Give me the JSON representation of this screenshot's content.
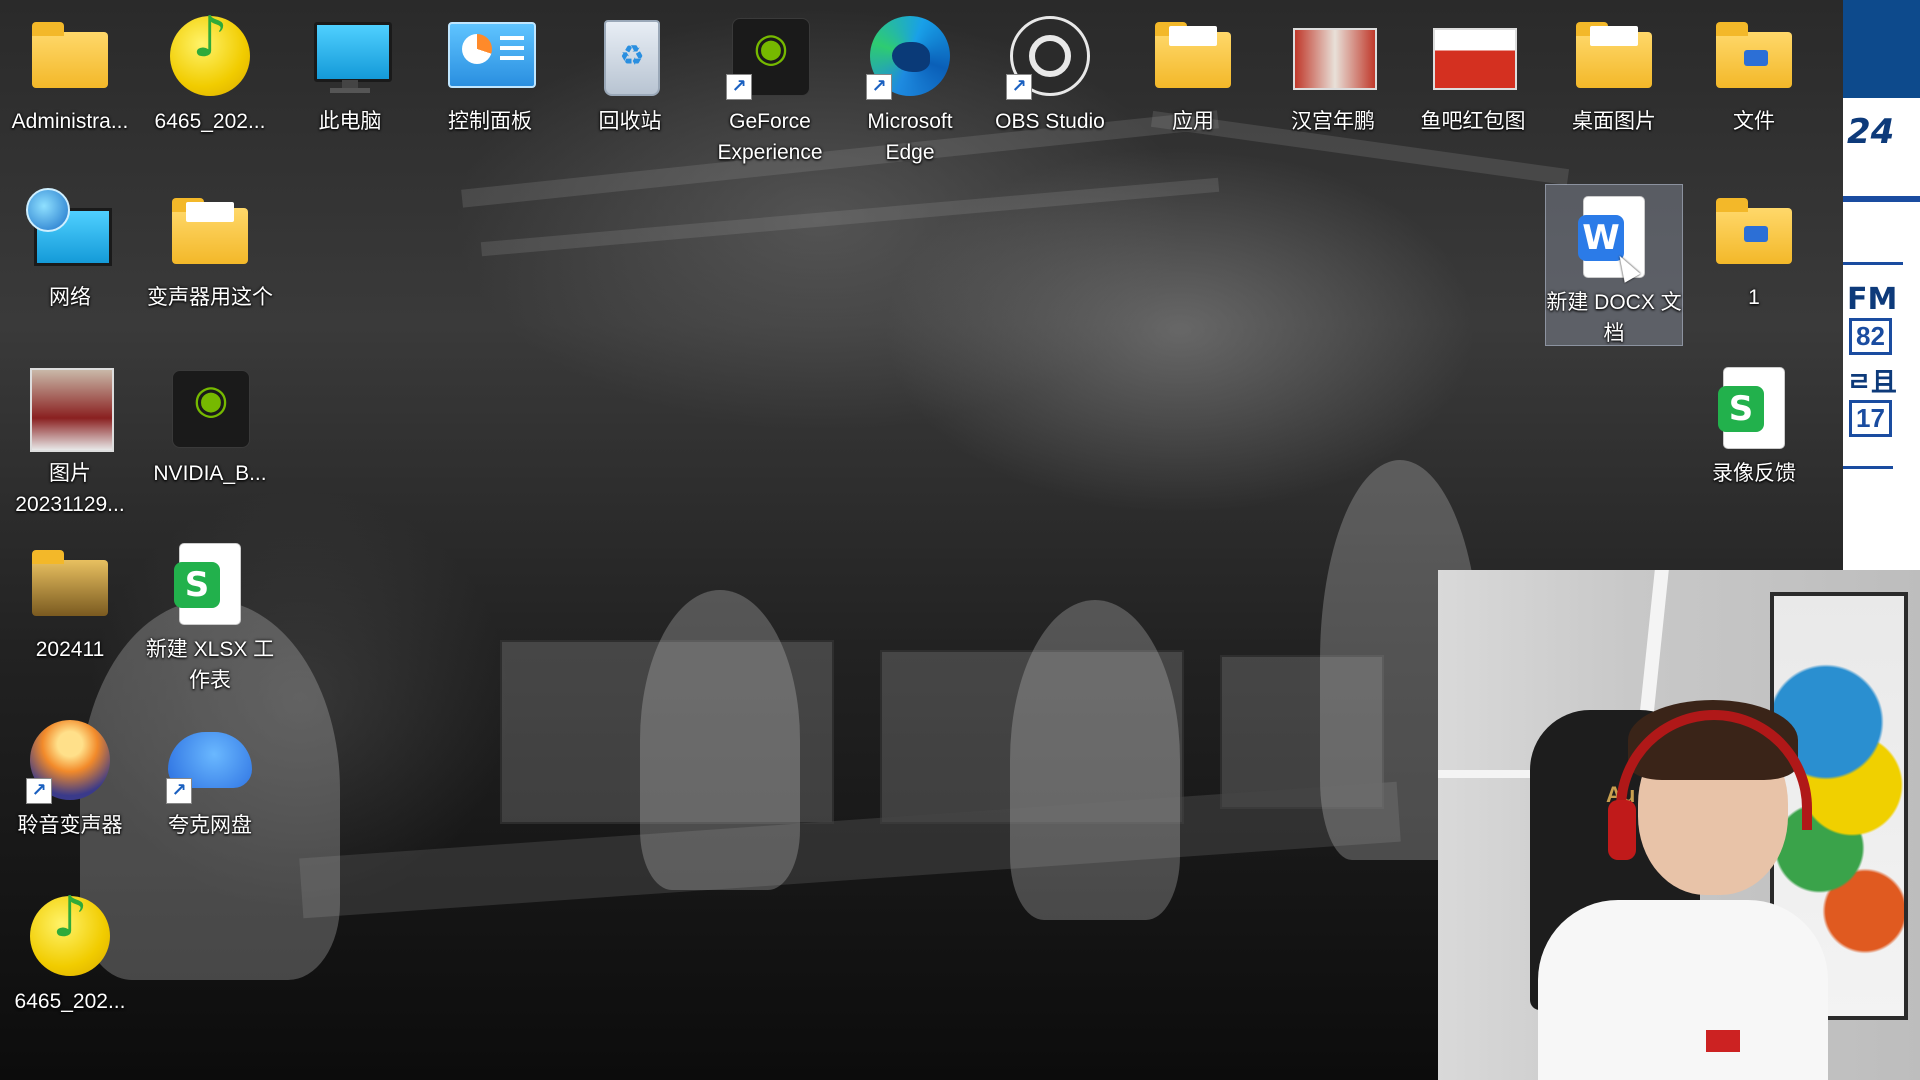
{
  "desktop": {
    "icons": [
      {
        "label": "Administra...",
        "kind": "folder"
      },
      {
        "label": "6465_202...",
        "kind": "music-app"
      },
      {
        "label": "此电脑",
        "kind": "this-pc"
      },
      {
        "label": "控制面板",
        "kind": "control-panel"
      },
      {
        "label": "回收站",
        "kind": "recycle-bin"
      },
      {
        "label": "GeForce Experience",
        "kind": "nvidia-shortcut"
      },
      {
        "label": "Microsoft Edge",
        "kind": "edge-shortcut"
      },
      {
        "label": "OBS Studio",
        "kind": "obs-shortcut"
      },
      {
        "label": "应用",
        "kind": "folder"
      },
      {
        "label": "汉宫年鹏",
        "kind": "image"
      },
      {
        "label": "鱼吧红包图",
        "kind": "image"
      },
      {
        "label": "桌面图片",
        "kind": "folder"
      },
      {
        "label": "文件",
        "kind": "folder"
      },
      {
        "label": "网络",
        "kind": "network"
      },
      {
        "label": "变声器用这个",
        "kind": "folder"
      },
      {
        "label": "新建 DOCX 文档",
        "kind": "docx",
        "selected": true
      },
      {
        "label": "1",
        "kind": "folder"
      },
      {
        "label": "图片 20231129...",
        "kind": "image"
      },
      {
        "label": "NVIDIA_B...",
        "kind": "nvidia"
      },
      {
        "label": "录像反馈",
        "kind": "xlsx"
      },
      {
        "label": "202411",
        "kind": "folder"
      },
      {
        "label": "新建 XLSX 工作表",
        "kind": "xlsx"
      },
      {
        "label": "聆音变声器",
        "kind": "voice-app-shortcut"
      },
      {
        "label": "夸克网盘",
        "kind": "cloud-shortcut"
      },
      {
        "label": "6465_202...",
        "kind": "music-app"
      }
    ]
  },
  "side_panel": {
    "text1": "24",
    "text2": "FM",
    "text3": "82",
    "text4": "ㄹ且",
    "text5": "17"
  },
  "webcam": {
    "chair_brand": "Au"
  },
  "colors": {
    "folder": "#f3b829",
    "selection": "#a0aabe",
    "panel_blue": "#0d4a8c",
    "nvidia_green": "#76b900"
  }
}
